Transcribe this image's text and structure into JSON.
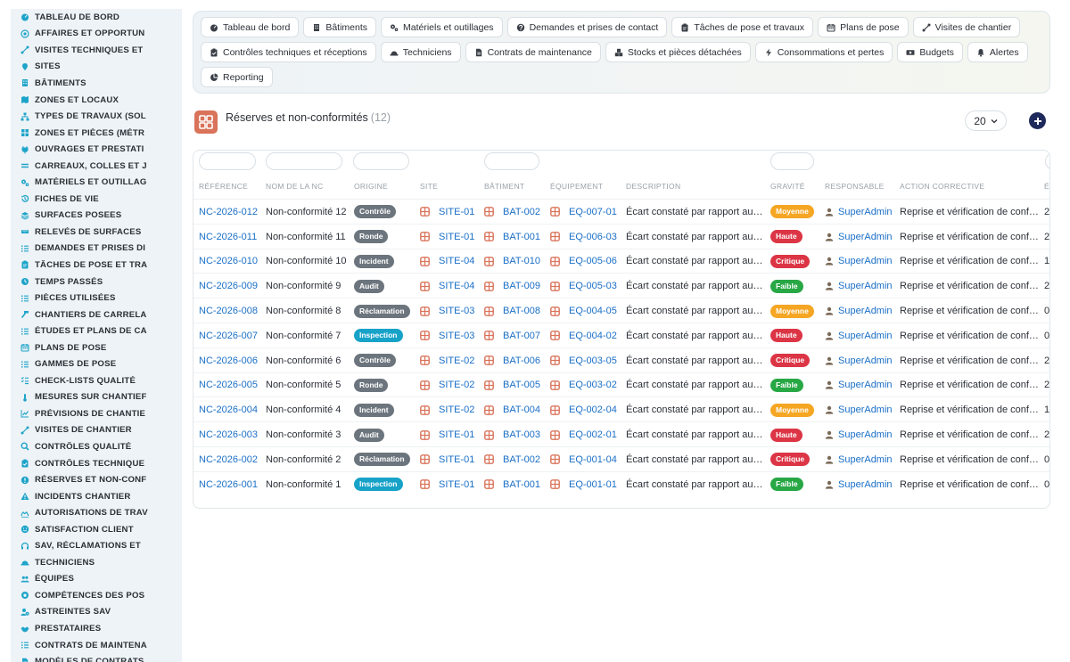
{
  "sidebar": {
    "items": [
      {
        "label": "TABLEAU DE BORD",
        "icon": "dashboard-icon"
      },
      {
        "label": "AFFAIRES ET OPPORTUN",
        "icon": "target-icon"
      },
      {
        "label": "VISITES TECHNIQUES ET",
        "icon": "route-icon"
      },
      {
        "label": "SITES",
        "icon": "pin-icon"
      },
      {
        "label": "BÂTIMENTS",
        "icon": "building-icon"
      },
      {
        "label": "ZONES ET LOCAUX",
        "icon": "map-icon"
      },
      {
        "label": "TYPES DE TRAVAUX (SOL",
        "icon": "sitemap-icon"
      },
      {
        "label": "ZONES ET PIÈCES (MÉTR",
        "icon": "grid-icon"
      },
      {
        "label": "OUVRAGES ET PRESTATI",
        "icon": "plug-icon"
      },
      {
        "label": "CARREAUX, COLLES ET J",
        "icon": "lines-icon"
      },
      {
        "label": "MATÉRIELS ET OUTILLAG",
        "icon": "gears-icon"
      },
      {
        "label": "FICHES DE VIE",
        "icon": "history-icon"
      },
      {
        "label": "SURFACES POSEES",
        "icon": "layer-icon"
      },
      {
        "label": "RELEVÉS DE SURFACES",
        "icon": "ruler-icon"
      },
      {
        "label": "DEMANDES ET PRISES DI",
        "icon": "list-icon"
      },
      {
        "label": "TÂCHES DE POSE ET TRA",
        "icon": "clipboard-icon"
      },
      {
        "label": "TEMPS PASSÉS",
        "icon": "clock-icon"
      },
      {
        "label": "PIÈCES UTILISÉES",
        "icon": "list-icon"
      },
      {
        "label": "CHANTIERS DE CARRELA",
        "icon": "hammer-icon"
      },
      {
        "label": "ÉTUDES ET PLANS DE CA",
        "icon": "list-icon"
      },
      {
        "label": "PLANS DE POSE",
        "icon": "calendar-icon"
      },
      {
        "label": "GAMMES DE POSE",
        "icon": "list-icon"
      },
      {
        "label": "CHECK-LISTS QUALITÉ",
        "icon": "checklist-icon"
      },
      {
        "label": "MESURES SUR CHANTIEF",
        "icon": "thermometer-icon"
      },
      {
        "label": "PRÉVISIONS DE CHANTIE",
        "icon": "chart-icon"
      },
      {
        "label": "VISITES DE CHANTIER",
        "icon": "route-icon"
      },
      {
        "label": "CONTRÔLES QUALITÉ",
        "icon": "search-icon"
      },
      {
        "label": "CONTRÔLES TECHNIQUE",
        "icon": "clipboard-check-icon"
      },
      {
        "label": "RÉSERVES ET NON-CONF",
        "icon": "warning-circle-icon"
      },
      {
        "label": "INCIDENTS CHANTIER",
        "icon": "warning-triangle-icon"
      },
      {
        "label": "AUTORISATIONS DE TRAV",
        "icon": "signature-icon"
      },
      {
        "label": "SATISFACTION CLIENT",
        "icon": "smile-icon"
      },
      {
        "label": "SAV, RÉCLAMATIONS ET",
        "icon": "headset-icon"
      },
      {
        "label": "TECHNICIENS",
        "icon": "hardhat-icon"
      },
      {
        "label": "ÉQUIPES",
        "icon": "users-icon"
      },
      {
        "label": "COMPÉTENCES DES POS",
        "icon": "badge-icon"
      },
      {
        "label": "ASTREINTES SAV",
        "icon": "user-clock-icon"
      },
      {
        "label": "PRESTATAIRES",
        "icon": "handshake-icon"
      },
      {
        "label": "CONTRATS DE MAINTENA",
        "icon": "list-icon"
      },
      {
        "label": "MODÈLES DE CONTRATS",
        "icon": "file-icon"
      }
    ]
  },
  "topnav": {
    "rows": [
      [
        {
          "label": "Tableau de bord",
          "icon": "dashboard-icon"
        },
        {
          "label": "Bâtiments",
          "icon": "building-icon"
        },
        {
          "label": "Matériels et outillages",
          "icon": "gears-icon"
        },
        {
          "label": "Demandes et prises de contact",
          "icon": "question-icon"
        },
        {
          "label": "Tâches de pose et travaux",
          "icon": "clipboard-icon"
        },
        {
          "label": "Plans de pose",
          "icon": "calendar-icon"
        },
        {
          "label": "Visites de chantier",
          "icon": "route-icon"
        }
      ],
      [
        {
          "label": "Contrôles techniques et réceptions",
          "icon": "clipboard-check-icon"
        },
        {
          "label": "Techniciens",
          "icon": "hardhat-icon"
        },
        {
          "label": "Contrats de maintenance",
          "icon": "file-icon"
        },
        {
          "label": "Stocks et pièces détachées",
          "icon": "boxes-icon"
        },
        {
          "label": "Consommations et pertes",
          "icon": "bolt-icon"
        },
        {
          "label": "Budgets",
          "icon": "money-icon"
        },
        {
          "label": "Alertes",
          "icon": "bell-icon"
        }
      ],
      [
        {
          "label": "Reporting",
          "icon": "pie-icon"
        }
      ]
    ]
  },
  "page": {
    "title": "Réserves et non-conformités",
    "count": "(12)",
    "page_size": "20"
  },
  "table": {
    "columns": [
      "RÉFÉRENCE",
      "NOM DE LA NC",
      "ORIGINE",
      "SITE",
      "BÂTIMENT",
      "ÉQUIPEMENT",
      "DESCRIPTION",
      "GRAVITÉ",
      "RESPONSABLE",
      "ACTION CORRECTIVE",
      "É"
    ],
    "rows": [
      {
        "ref": "NC-2026-012",
        "name": "Non-conformité 12",
        "origin": "Contrôle",
        "site": "SITE-01",
        "building": "BAT-002",
        "equipment": "EQ-007-01",
        "description": "Écart constaté par rapport au…",
        "severity": "Moyenne",
        "owner": "SuperAdmin",
        "action": "Reprise et vérification de conf…",
        "extra": "2"
      },
      {
        "ref": "NC-2026-011",
        "name": "Non-conformité 11",
        "origin": "Ronde",
        "site": "SITE-01",
        "building": "BAT-001",
        "equipment": "EQ-006-03",
        "description": "Écart constaté par rapport au…",
        "severity": "Haute",
        "owner": "SuperAdmin",
        "action": "Reprise et vérification de conf…",
        "extra": "2"
      },
      {
        "ref": "NC-2026-010",
        "name": "Non-conformité 10",
        "origin": "Incident",
        "site": "SITE-04",
        "building": "BAT-010",
        "equipment": "EQ-005-06",
        "description": "Écart constaté par rapport au…",
        "severity": "Critique",
        "owner": "SuperAdmin",
        "action": "Reprise et vérification de conf…",
        "extra": "1"
      },
      {
        "ref": "NC-2026-009",
        "name": "Non-conformité 9",
        "origin": "Audit",
        "site": "SITE-04",
        "building": "BAT-009",
        "equipment": "EQ-005-03",
        "description": "Écart constaté par rapport au…",
        "severity": "Faible",
        "owner": "SuperAdmin",
        "action": "Reprise et vérification de conf…",
        "extra": "2"
      },
      {
        "ref": "NC-2026-008",
        "name": "Non-conformité 8",
        "origin": "Réclamation",
        "site": "SITE-03",
        "building": "BAT-008",
        "equipment": "EQ-004-05",
        "description": "Écart constaté par rapport au…",
        "severity": "Moyenne",
        "owner": "SuperAdmin",
        "action": "Reprise et vérification de conf…",
        "extra": "0"
      },
      {
        "ref": "NC-2026-007",
        "name": "Non-conformité 7",
        "origin": "Inspection",
        "site": "SITE-03",
        "building": "BAT-007",
        "equipment": "EQ-004-02",
        "description": "Écart constaté par rapport au…",
        "severity": "Haute",
        "owner": "SuperAdmin",
        "action": "Reprise et vérification de conf…",
        "extra": "0"
      },
      {
        "ref": "NC-2026-006",
        "name": "Non-conformité 6",
        "origin": "Contrôle",
        "site": "SITE-02",
        "building": "BAT-006",
        "equipment": "EQ-003-05",
        "description": "Écart constaté par rapport au…",
        "severity": "Critique",
        "owner": "SuperAdmin",
        "action": "Reprise et vérification de conf…",
        "extra": "2"
      },
      {
        "ref": "NC-2026-005",
        "name": "Non-conformité 5",
        "origin": "Ronde",
        "site": "SITE-02",
        "building": "BAT-005",
        "equipment": "EQ-003-02",
        "description": "Écart constaté par rapport au…",
        "severity": "Faible",
        "owner": "SuperAdmin",
        "action": "Reprise et vérification de conf…",
        "extra": "2"
      },
      {
        "ref": "NC-2026-004",
        "name": "Non-conformité 4",
        "origin": "Incident",
        "site": "SITE-02",
        "building": "BAT-004",
        "equipment": "EQ-002-04",
        "description": "Écart constaté par rapport au…",
        "severity": "Moyenne",
        "owner": "SuperAdmin",
        "action": "Reprise et vérification de conf…",
        "extra": "1"
      },
      {
        "ref": "NC-2026-003",
        "name": "Non-conformité 3",
        "origin": "Audit",
        "site": "SITE-01",
        "building": "BAT-003",
        "equipment": "EQ-002-01",
        "description": "Écart constaté par rapport au…",
        "severity": "Haute",
        "owner": "SuperAdmin",
        "action": "Reprise et vérification de conf…",
        "extra": "2"
      },
      {
        "ref": "NC-2026-002",
        "name": "Non-conformité 2",
        "origin": "Réclamation",
        "site": "SITE-01",
        "building": "BAT-002",
        "equipment": "EQ-001-04",
        "description": "Écart constaté par rapport au…",
        "severity": "Critique",
        "owner": "SuperAdmin",
        "action": "Reprise et vérification de conf…",
        "extra": "0"
      },
      {
        "ref": "NC-2026-001",
        "name": "Non-conformité 1",
        "origin": "Inspection",
        "site": "SITE-01",
        "building": "BAT-001",
        "equipment": "EQ-001-01",
        "description": "Écart constaté par rapport au…",
        "severity": "Faible",
        "owner": "SuperAdmin",
        "action": "Reprise et vérification de conf…",
        "extra": "0"
      }
    ]
  },
  "colors": {
    "sidebar_icon": "#1fa4c9",
    "link": "#1a6fc6",
    "entity_icon": "#d9735a",
    "add_button": "#1f2a5c",
    "origin_badges": {
      "Contrôle": "#6c757d",
      "Ronde": "#6c757d",
      "Incident": "#6c757d",
      "Audit": "#6c757d",
      "Réclamation": "#6c757d",
      "Inspection": "#17a2c8"
    },
    "severity_badges": {
      "Moyenne": "#f5a623",
      "Haute": "#dc3545",
      "Critique": "#dc3545",
      "Faible": "#28a745"
    }
  }
}
